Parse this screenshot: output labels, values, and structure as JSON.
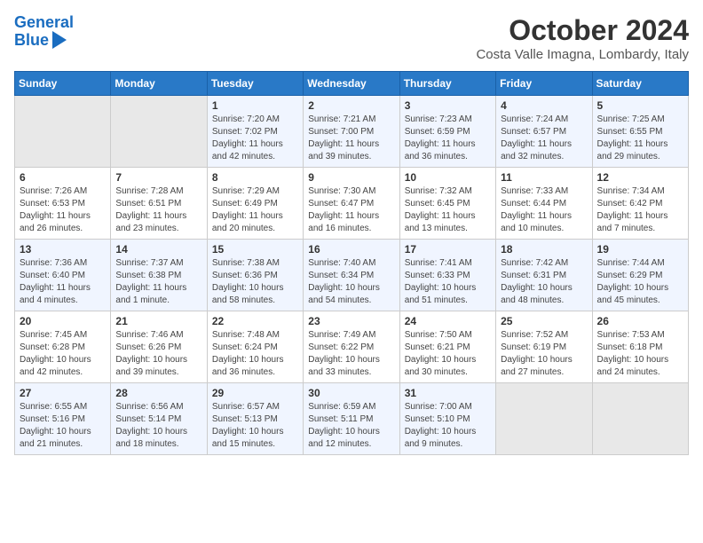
{
  "header": {
    "logo_line1": "General",
    "logo_line2": "Blue",
    "month": "October 2024",
    "location": "Costa Valle Imagna, Lombardy, Italy"
  },
  "weekdays": [
    "Sunday",
    "Monday",
    "Tuesday",
    "Wednesday",
    "Thursday",
    "Friday",
    "Saturday"
  ],
  "weeks": [
    [
      {
        "day": "",
        "empty": true
      },
      {
        "day": "",
        "empty": true
      },
      {
        "day": "1",
        "sunrise": "Sunrise: 7:20 AM",
        "sunset": "Sunset: 7:02 PM",
        "daylight": "Daylight: 11 hours and 42 minutes."
      },
      {
        "day": "2",
        "sunrise": "Sunrise: 7:21 AM",
        "sunset": "Sunset: 7:00 PM",
        "daylight": "Daylight: 11 hours and 39 minutes."
      },
      {
        "day": "3",
        "sunrise": "Sunrise: 7:23 AM",
        "sunset": "Sunset: 6:59 PM",
        "daylight": "Daylight: 11 hours and 36 minutes."
      },
      {
        "day": "4",
        "sunrise": "Sunrise: 7:24 AM",
        "sunset": "Sunset: 6:57 PM",
        "daylight": "Daylight: 11 hours and 32 minutes."
      },
      {
        "day": "5",
        "sunrise": "Sunrise: 7:25 AM",
        "sunset": "Sunset: 6:55 PM",
        "daylight": "Daylight: 11 hours and 29 minutes."
      }
    ],
    [
      {
        "day": "6",
        "sunrise": "Sunrise: 7:26 AM",
        "sunset": "Sunset: 6:53 PM",
        "daylight": "Daylight: 11 hours and 26 minutes."
      },
      {
        "day": "7",
        "sunrise": "Sunrise: 7:28 AM",
        "sunset": "Sunset: 6:51 PM",
        "daylight": "Daylight: 11 hours and 23 minutes."
      },
      {
        "day": "8",
        "sunrise": "Sunrise: 7:29 AM",
        "sunset": "Sunset: 6:49 PM",
        "daylight": "Daylight: 11 hours and 20 minutes."
      },
      {
        "day": "9",
        "sunrise": "Sunrise: 7:30 AM",
        "sunset": "Sunset: 6:47 PM",
        "daylight": "Daylight: 11 hours and 16 minutes."
      },
      {
        "day": "10",
        "sunrise": "Sunrise: 7:32 AM",
        "sunset": "Sunset: 6:45 PM",
        "daylight": "Daylight: 11 hours and 13 minutes."
      },
      {
        "day": "11",
        "sunrise": "Sunrise: 7:33 AM",
        "sunset": "Sunset: 6:44 PM",
        "daylight": "Daylight: 11 hours and 10 minutes."
      },
      {
        "day": "12",
        "sunrise": "Sunrise: 7:34 AM",
        "sunset": "Sunset: 6:42 PM",
        "daylight": "Daylight: 11 hours and 7 minutes."
      }
    ],
    [
      {
        "day": "13",
        "sunrise": "Sunrise: 7:36 AM",
        "sunset": "Sunset: 6:40 PM",
        "daylight": "Daylight: 11 hours and 4 minutes."
      },
      {
        "day": "14",
        "sunrise": "Sunrise: 7:37 AM",
        "sunset": "Sunset: 6:38 PM",
        "daylight": "Daylight: 11 hours and 1 minute."
      },
      {
        "day": "15",
        "sunrise": "Sunrise: 7:38 AM",
        "sunset": "Sunset: 6:36 PM",
        "daylight": "Daylight: 10 hours and 58 minutes."
      },
      {
        "day": "16",
        "sunrise": "Sunrise: 7:40 AM",
        "sunset": "Sunset: 6:34 PM",
        "daylight": "Daylight: 10 hours and 54 minutes."
      },
      {
        "day": "17",
        "sunrise": "Sunrise: 7:41 AM",
        "sunset": "Sunset: 6:33 PM",
        "daylight": "Daylight: 10 hours and 51 minutes."
      },
      {
        "day": "18",
        "sunrise": "Sunrise: 7:42 AM",
        "sunset": "Sunset: 6:31 PM",
        "daylight": "Daylight: 10 hours and 48 minutes."
      },
      {
        "day": "19",
        "sunrise": "Sunrise: 7:44 AM",
        "sunset": "Sunset: 6:29 PM",
        "daylight": "Daylight: 10 hours and 45 minutes."
      }
    ],
    [
      {
        "day": "20",
        "sunrise": "Sunrise: 7:45 AM",
        "sunset": "Sunset: 6:28 PM",
        "daylight": "Daylight: 10 hours and 42 minutes."
      },
      {
        "day": "21",
        "sunrise": "Sunrise: 7:46 AM",
        "sunset": "Sunset: 6:26 PM",
        "daylight": "Daylight: 10 hours and 39 minutes."
      },
      {
        "day": "22",
        "sunrise": "Sunrise: 7:48 AM",
        "sunset": "Sunset: 6:24 PM",
        "daylight": "Daylight: 10 hours and 36 minutes."
      },
      {
        "day": "23",
        "sunrise": "Sunrise: 7:49 AM",
        "sunset": "Sunset: 6:22 PM",
        "daylight": "Daylight: 10 hours and 33 minutes."
      },
      {
        "day": "24",
        "sunrise": "Sunrise: 7:50 AM",
        "sunset": "Sunset: 6:21 PM",
        "daylight": "Daylight: 10 hours and 30 minutes."
      },
      {
        "day": "25",
        "sunrise": "Sunrise: 7:52 AM",
        "sunset": "Sunset: 6:19 PM",
        "daylight": "Daylight: 10 hours and 27 minutes."
      },
      {
        "day": "26",
        "sunrise": "Sunrise: 7:53 AM",
        "sunset": "Sunset: 6:18 PM",
        "daylight": "Daylight: 10 hours and 24 minutes."
      }
    ],
    [
      {
        "day": "27",
        "sunrise": "Sunrise: 6:55 AM",
        "sunset": "Sunset: 5:16 PM",
        "daylight": "Daylight: 10 hours and 21 minutes."
      },
      {
        "day": "28",
        "sunrise": "Sunrise: 6:56 AM",
        "sunset": "Sunset: 5:14 PM",
        "daylight": "Daylight: 10 hours and 18 minutes."
      },
      {
        "day": "29",
        "sunrise": "Sunrise: 6:57 AM",
        "sunset": "Sunset: 5:13 PM",
        "daylight": "Daylight: 10 hours and 15 minutes."
      },
      {
        "day": "30",
        "sunrise": "Sunrise: 6:59 AM",
        "sunset": "Sunset: 5:11 PM",
        "daylight": "Daylight: 10 hours and 12 minutes."
      },
      {
        "day": "31",
        "sunrise": "Sunrise: 7:00 AM",
        "sunset": "Sunset: 5:10 PM",
        "daylight": "Daylight: 10 hours and 9 minutes."
      },
      {
        "day": "",
        "empty": true
      },
      {
        "day": "",
        "empty": true
      }
    ]
  ]
}
